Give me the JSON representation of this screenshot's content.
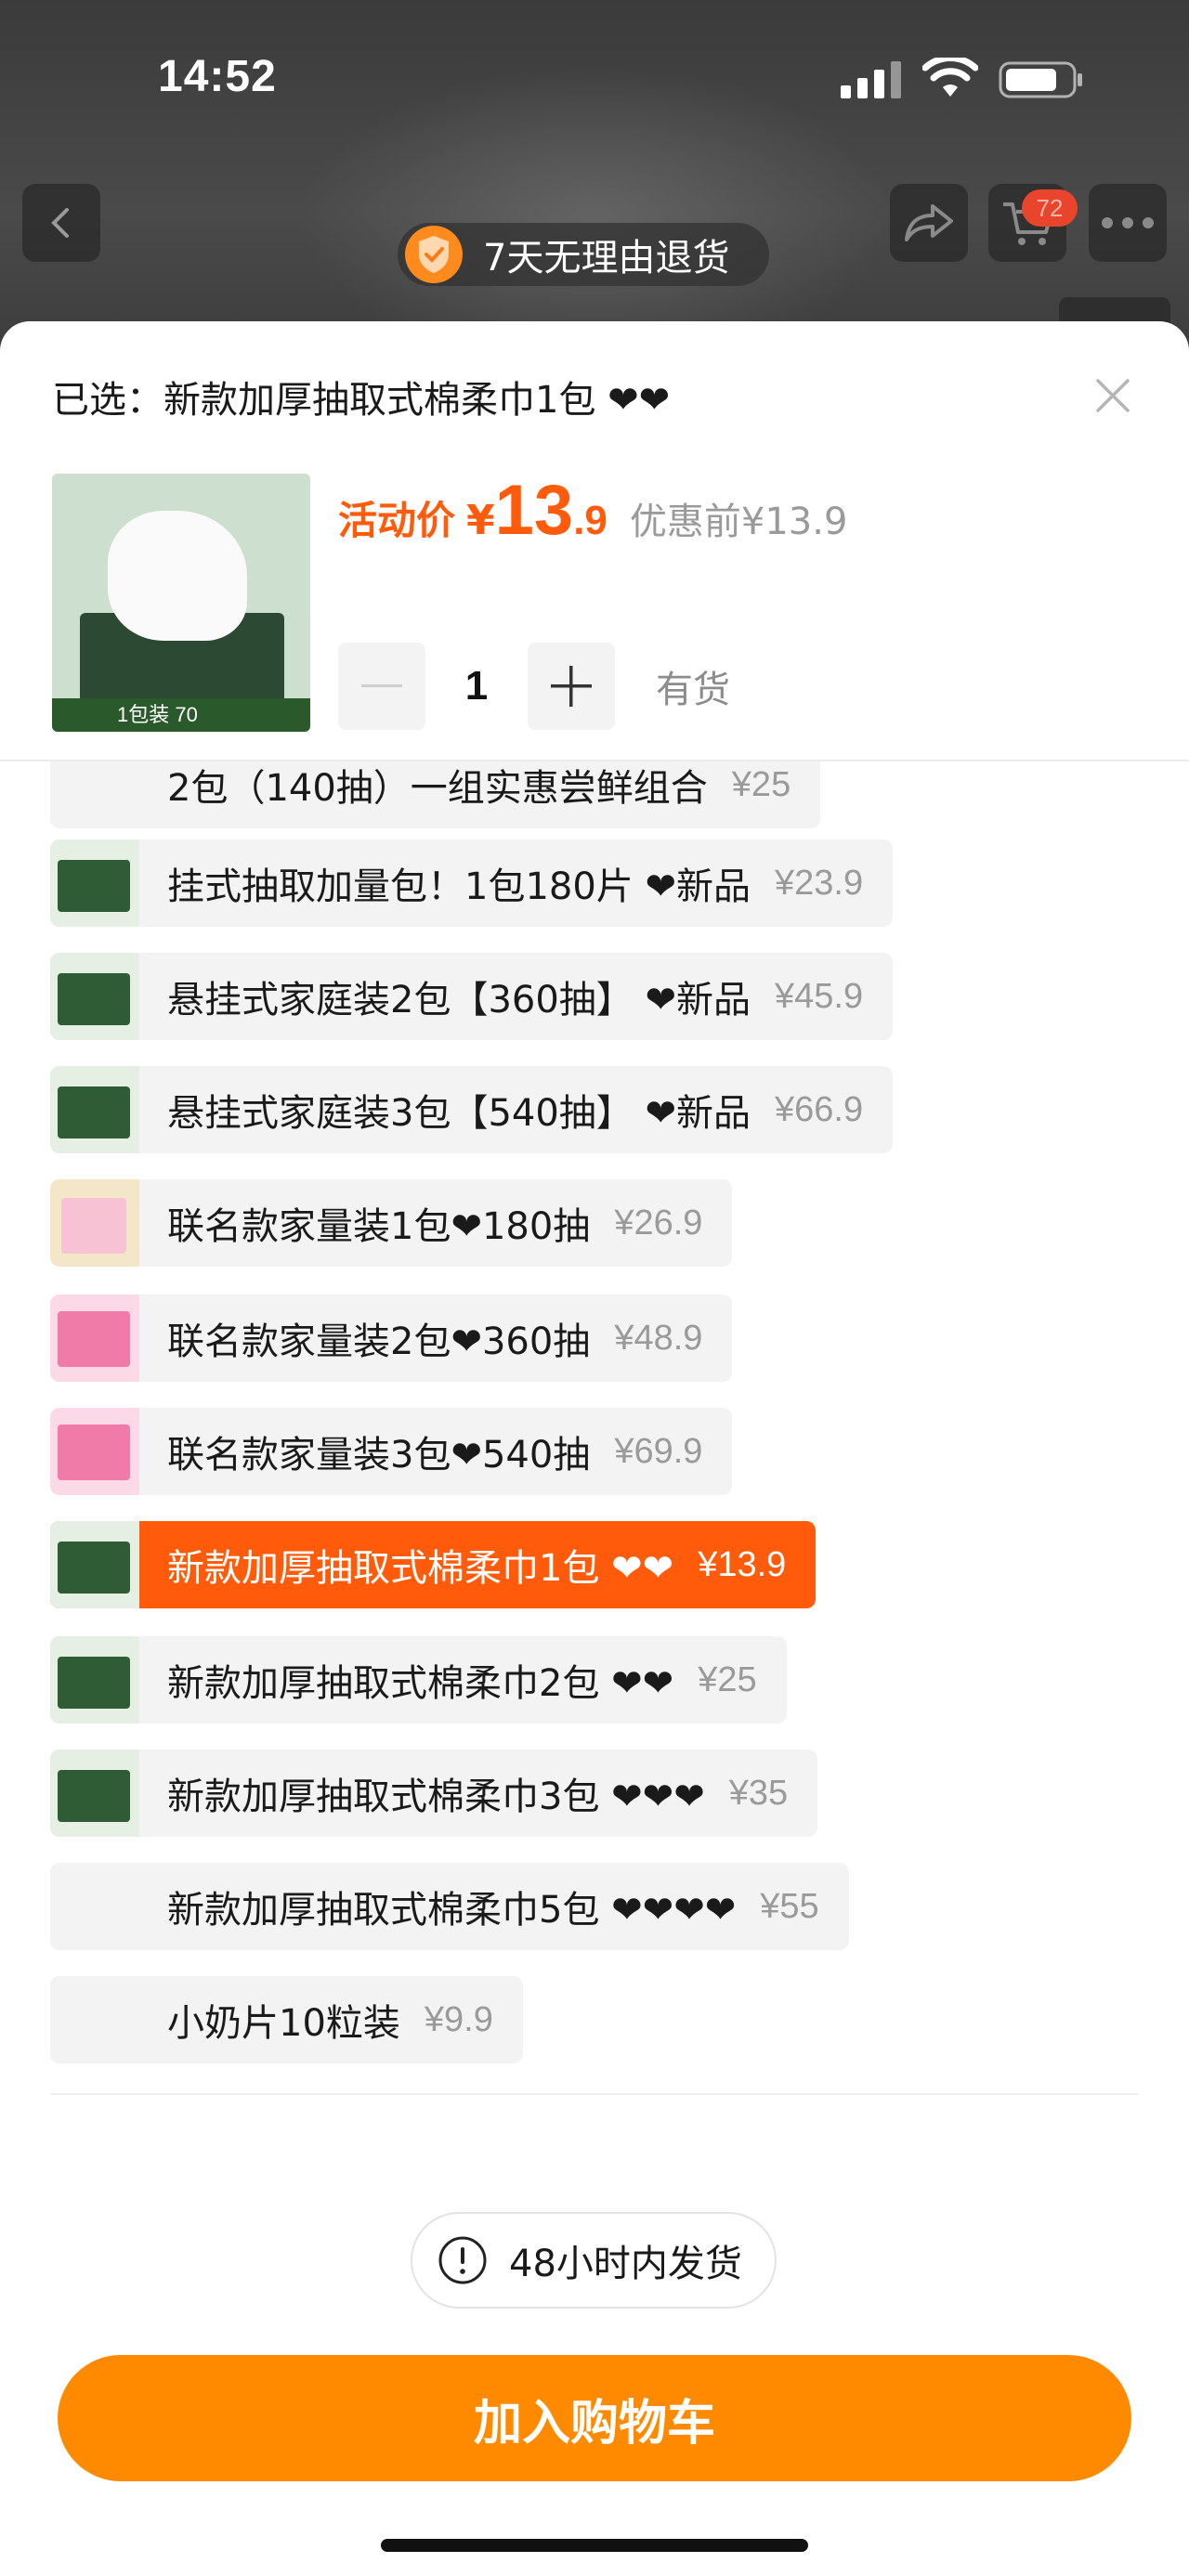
{
  "status_bar": {
    "time": "14:52"
  },
  "top_nav": {
    "cart_badge": "72",
    "return_policy": "7天无理由退货"
  },
  "sheet": {
    "selected_text": "已选：新款加厚抽取式棉柔巾1包 ❤❤",
    "hero_band_label": "1包装   70",
    "price": {
      "label": "活动价",
      "currency": "¥",
      "integer": "13",
      "decimal": ".9",
      "before": "优惠前¥13.9"
    },
    "quantity": {
      "value": "1",
      "stock": "有货"
    }
  },
  "options": [
    {
      "label": "2包（140抽）一组实惠尝鲜组合",
      "price": "¥25",
      "thumb": "none"
    },
    {
      "label": "挂式抽取加量包！1包180片 ❤新品",
      "price": "¥23.9",
      "thumb": "green"
    },
    {
      "label": "悬挂式家庭装2包【360抽】 ❤新品",
      "price": "¥45.9",
      "thumb": "green"
    },
    {
      "label": "悬挂式家庭装3包【540抽】 ❤新品",
      "price": "¥66.9",
      "thumb": "green"
    },
    {
      "label": "联名款家量装1包❤180抽",
      "price": "¥26.9",
      "thumb": "cream"
    },
    {
      "label": "联名款家量装2包❤360抽",
      "price": "¥48.9",
      "thumb": "pink"
    },
    {
      "label": "联名款家量装3包❤540抽",
      "price": "¥69.9",
      "thumb": "pink"
    },
    {
      "label": "新款加厚抽取式棉柔巾1包 ❤❤",
      "price": "¥13.9",
      "thumb": "green",
      "selected": true
    },
    {
      "label": "新款加厚抽取式棉柔巾2包 ❤❤",
      "price": "¥25",
      "thumb": "green"
    },
    {
      "label": "新款加厚抽取式棉柔巾3包 ❤❤❤",
      "price": "¥35",
      "thumb": "green"
    },
    {
      "label": "新款加厚抽取式棉柔巾5包 ❤❤❤❤",
      "price": "¥55",
      "thumb": "none"
    },
    {
      "label": "小奶片10粒装",
      "price": "¥9.9",
      "thumb": "none"
    }
  ],
  "shipping_notice": "48小时内发货",
  "add_to_cart": "加入购物车",
  "colors": {
    "accent": "#ff5b0a",
    "cta": "#ff8a00",
    "badge": "#e8452c"
  }
}
